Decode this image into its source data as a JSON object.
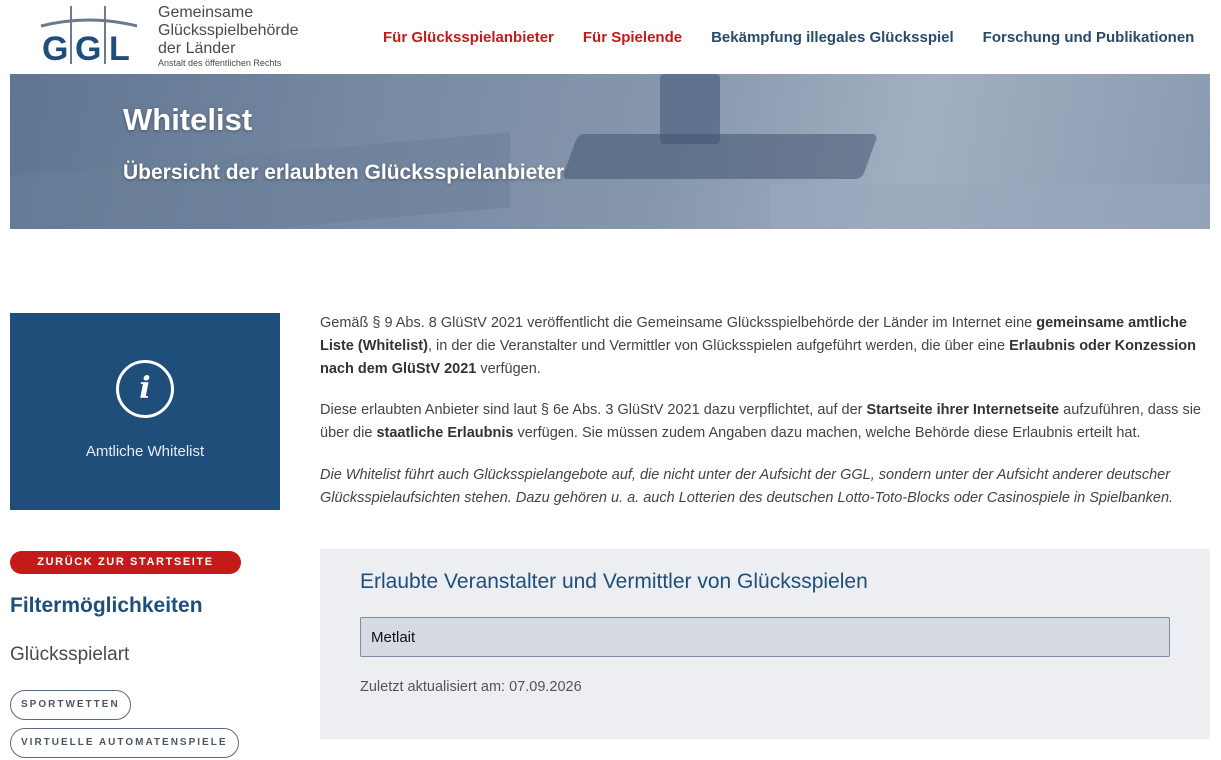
{
  "logo": {
    "letters": "GGL",
    "line1": "Gemeinsame",
    "line2": "Glücksspielbehörde",
    "line3": "der Länder",
    "tagline": "Anstalt des öffentlichen Rechts"
  },
  "nav": [
    {
      "label": "Für Glücksspielanbieter",
      "color": "#c41a1a"
    },
    {
      "label": "Für Spielende",
      "color": "#c41a1a"
    },
    {
      "label": "Bekämpfung illegales Glücksspiel",
      "color": "#2a4a6b"
    },
    {
      "label": "Forschung und Publikationen",
      "color": "#2a4a6b"
    }
  ],
  "hero": {
    "title": "Whitelist",
    "subtitle": "Übersicht der erlaubten Glücksspielanbieter"
  },
  "sidebar": {
    "tile_label": "Amtliche Whitelist",
    "tile_icon": "info-icon",
    "back_button": "ZURÜCK ZUR STARTSEITE",
    "filter_title": "Filtermöglichkeiten",
    "filter_group": "Glücksspielart",
    "chips": [
      "SPORTWETTEN",
      "VIRTUELLE AUTOMATENSPIELE"
    ]
  },
  "content": {
    "p1_a": "Gemäß § 9 Abs. 8 GlüStV 2021 veröffentlicht die Gemeinsame Glücksspielbehörde der Länder im Internet eine ",
    "p1_b": "gemeinsame amtliche Liste (Whitelist)",
    "p1_c": ", in der die Veranstalter und Vermittler von Glücksspielen aufgeführt werden, die über eine ",
    "p1_d": "Erlaubnis oder Konzession nach dem GlüStV 2021",
    "p1_e": " verfügen.",
    "p2_a": "Diese erlaubten Anbieter sind laut § 6e Abs. 3 GlüStV 2021 dazu verpflichtet, auf der ",
    "p2_b": "Startseite ihrer Internetseite",
    "p2_c": " aufzuführen, dass sie über die ",
    "p2_d": "staatliche Erlaubnis",
    "p2_e": " verfügen. Sie müssen zudem Angaben dazu machen, welche Behörde diese Erlaubnis erteilt hat.",
    "p3": "Die Whitelist führt auch Glücksspielangebote auf, die nicht unter der Aufsicht der GGL, sondern unter der Aufsicht anderer deutscher Glücksspielaufsichten stehen. Dazu gehören u. a. auch Lotterien des deutschen Lotto-Toto-Blocks oder Casinospiele in Spielbanken."
  },
  "search_panel": {
    "title": "Erlaubte Veranstalter und Vermittler von Glücksspielen",
    "search_value": "Metlait",
    "updated_label": "Zuletzt aktualisiert am:",
    "updated_date": "07.09.2026"
  },
  "colors": {
    "brand_blue": "#1f4e7a",
    "brand_red": "#c41a1a"
  }
}
